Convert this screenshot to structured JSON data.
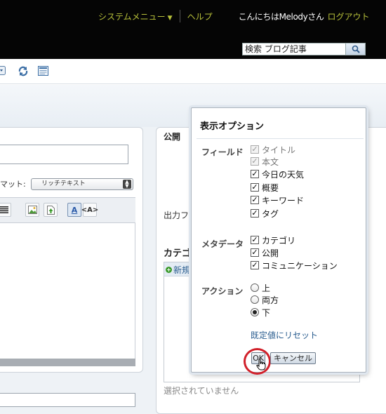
{
  "header": {
    "system_menu": "システムメニュー",
    "system_menu_arrow": "▼",
    "help": "ヘルプ",
    "greeting": "こんにちはMelodyさん",
    "logout": "ログアウト",
    "search": {
      "value": "検索 ブログ記事",
      "icon": "magnifier-icon"
    }
  },
  "toolbar": {
    "icons": [
      "dropdown-icon",
      "refresh-icon",
      "layout-icon"
    ]
  },
  "editor": {
    "format_label": "マット:",
    "format_value": "リッチテキスト",
    "toolbar_icons": [
      "align-icon",
      "insert-image-icon",
      "insert-file-icon",
      "text-color-icon",
      "html-mode-icon"
    ],
    "text_color_glyph": "A",
    "html_glyph": "<A>"
  },
  "sidebar": {
    "publish_title": "公開",
    "output_label": "出力フ",
    "category_title": "カテゴ",
    "new_category": "新規",
    "none_selected": "選択されていません"
  },
  "dialog": {
    "title": "表示オプション",
    "fields_label": "フィールド",
    "fields": [
      {
        "label": "タイトル",
        "checked": true,
        "disabled": true
      },
      {
        "label": "本文",
        "checked": true,
        "disabled": true
      },
      {
        "label": "今日の天気",
        "checked": true,
        "disabled": false
      },
      {
        "label": "概要",
        "checked": true,
        "disabled": false
      },
      {
        "label": "キーワード",
        "checked": true,
        "disabled": false
      },
      {
        "label": "タグ",
        "checked": true,
        "disabled": false
      }
    ],
    "meta_label": "メタデータ",
    "meta": [
      {
        "label": "カテゴリ",
        "checked": true
      },
      {
        "label": "公開",
        "checked": true
      },
      {
        "label": "コミュニケーション",
        "checked": true
      }
    ],
    "action_label": "アクション",
    "actions": [
      {
        "label": "上",
        "selected": false
      },
      {
        "label": "両方",
        "selected": false
      },
      {
        "label": "下",
        "selected": true
      }
    ],
    "reset": "既定値にリセット",
    "ok": "OK",
    "cancel": "キャンセル"
  },
  "colors": {
    "header_bg": "#050505",
    "header_link": "#b8c13a",
    "highlight_ring": "#d1202a",
    "link": "#2a5d8f"
  }
}
